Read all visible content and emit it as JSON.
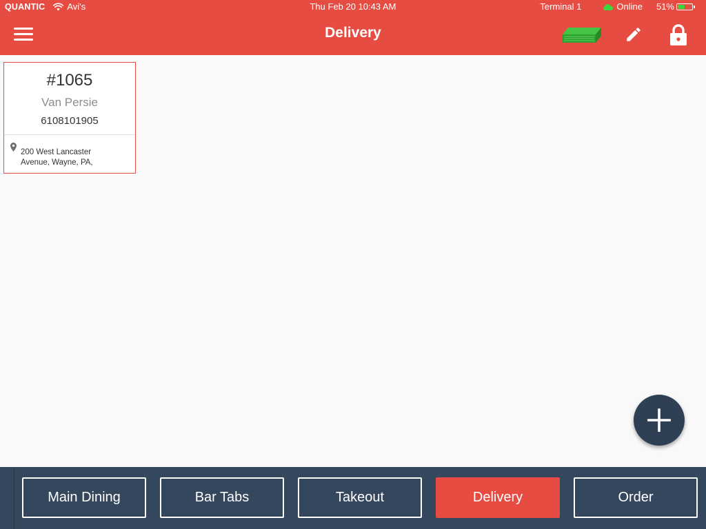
{
  "status_bar": {
    "carrier": "QUANTIC",
    "network": "Avi's",
    "datetime": "Thu Feb 20 10:43 AM",
    "terminal": "Terminal 1",
    "connection": "Online",
    "battery": "51%",
    "battery_level": 0.51
  },
  "header": {
    "title": "Delivery",
    "icons": [
      "menu-icon",
      "cash-drawer-icon",
      "pencil-icon",
      "lock-icon"
    ]
  },
  "orders": [
    {
      "number": "#1065",
      "customer": "Van Persie",
      "phone": "6108101905",
      "address_line1": "200 West Lancaster",
      "address_line2": "Avenue, Wayne, PA,"
    }
  ],
  "fab": {
    "icon": "plus-icon"
  },
  "bottom_tabs": [
    {
      "label": "Main Dining",
      "active": false
    },
    {
      "label": "Bar Tabs",
      "active": false
    },
    {
      "label": "Takeout",
      "active": false
    },
    {
      "label": "Delivery",
      "active": true
    },
    {
      "label": "Order",
      "active": false
    }
  ],
  "colors": {
    "brand_red": "#e74c43",
    "navy": "#34475d",
    "fab_navy": "#2f3f54",
    "drawer_green": "#3cb93c",
    "online_green": "#3bd63b"
  }
}
